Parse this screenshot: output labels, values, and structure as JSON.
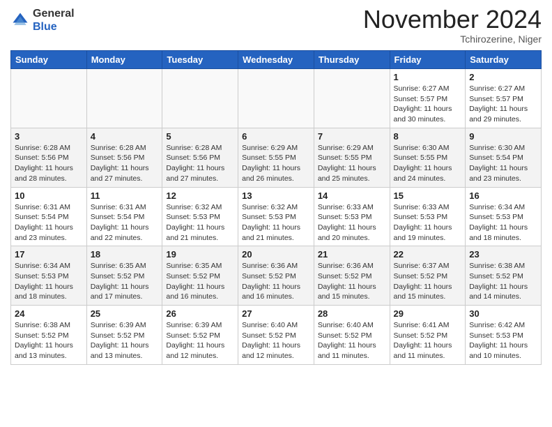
{
  "header": {
    "logo_general": "General",
    "logo_blue": "Blue",
    "month": "November 2024",
    "location": "Tchirozerine, Niger"
  },
  "weekdays": [
    "Sunday",
    "Monday",
    "Tuesday",
    "Wednesday",
    "Thursday",
    "Friday",
    "Saturday"
  ],
  "weeks": [
    [
      {
        "day": "",
        "info": ""
      },
      {
        "day": "",
        "info": ""
      },
      {
        "day": "",
        "info": ""
      },
      {
        "day": "",
        "info": ""
      },
      {
        "day": "",
        "info": ""
      },
      {
        "day": "1",
        "info": "Sunrise: 6:27 AM\nSunset: 5:57 PM\nDaylight: 11 hours and 30 minutes."
      },
      {
        "day": "2",
        "info": "Sunrise: 6:27 AM\nSunset: 5:57 PM\nDaylight: 11 hours and 29 minutes."
      }
    ],
    [
      {
        "day": "3",
        "info": "Sunrise: 6:28 AM\nSunset: 5:56 PM\nDaylight: 11 hours and 28 minutes."
      },
      {
        "day": "4",
        "info": "Sunrise: 6:28 AM\nSunset: 5:56 PM\nDaylight: 11 hours and 27 minutes."
      },
      {
        "day": "5",
        "info": "Sunrise: 6:28 AM\nSunset: 5:56 PM\nDaylight: 11 hours and 27 minutes."
      },
      {
        "day": "6",
        "info": "Sunrise: 6:29 AM\nSunset: 5:55 PM\nDaylight: 11 hours and 26 minutes."
      },
      {
        "day": "7",
        "info": "Sunrise: 6:29 AM\nSunset: 5:55 PM\nDaylight: 11 hours and 25 minutes."
      },
      {
        "day": "8",
        "info": "Sunrise: 6:30 AM\nSunset: 5:55 PM\nDaylight: 11 hours and 24 minutes."
      },
      {
        "day": "9",
        "info": "Sunrise: 6:30 AM\nSunset: 5:54 PM\nDaylight: 11 hours and 23 minutes."
      }
    ],
    [
      {
        "day": "10",
        "info": "Sunrise: 6:31 AM\nSunset: 5:54 PM\nDaylight: 11 hours and 23 minutes."
      },
      {
        "day": "11",
        "info": "Sunrise: 6:31 AM\nSunset: 5:54 PM\nDaylight: 11 hours and 22 minutes."
      },
      {
        "day": "12",
        "info": "Sunrise: 6:32 AM\nSunset: 5:53 PM\nDaylight: 11 hours and 21 minutes."
      },
      {
        "day": "13",
        "info": "Sunrise: 6:32 AM\nSunset: 5:53 PM\nDaylight: 11 hours and 21 minutes."
      },
      {
        "day": "14",
        "info": "Sunrise: 6:33 AM\nSunset: 5:53 PM\nDaylight: 11 hours and 20 minutes."
      },
      {
        "day": "15",
        "info": "Sunrise: 6:33 AM\nSunset: 5:53 PM\nDaylight: 11 hours and 19 minutes."
      },
      {
        "day": "16",
        "info": "Sunrise: 6:34 AM\nSunset: 5:53 PM\nDaylight: 11 hours and 18 minutes."
      }
    ],
    [
      {
        "day": "17",
        "info": "Sunrise: 6:34 AM\nSunset: 5:53 PM\nDaylight: 11 hours and 18 minutes."
      },
      {
        "day": "18",
        "info": "Sunrise: 6:35 AM\nSunset: 5:52 PM\nDaylight: 11 hours and 17 minutes."
      },
      {
        "day": "19",
        "info": "Sunrise: 6:35 AM\nSunset: 5:52 PM\nDaylight: 11 hours and 16 minutes."
      },
      {
        "day": "20",
        "info": "Sunrise: 6:36 AM\nSunset: 5:52 PM\nDaylight: 11 hours and 16 minutes."
      },
      {
        "day": "21",
        "info": "Sunrise: 6:36 AM\nSunset: 5:52 PM\nDaylight: 11 hours and 15 minutes."
      },
      {
        "day": "22",
        "info": "Sunrise: 6:37 AM\nSunset: 5:52 PM\nDaylight: 11 hours and 15 minutes."
      },
      {
        "day": "23",
        "info": "Sunrise: 6:38 AM\nSunset: 5:52 PM\nDaylight: 11 hours and 14 minutes."
      }
    ],
    [
      {
        "day": "24",
        "info": "Sunrise: 6:38 AM\nSunset: 5:52 PM\nDaylight: 11 hours and 13 minutes."
      },
      {
        "day": "25",
        "info": "Sunrise: 6:39 AM\nSunset: 5:52 PM\nDaylight: 11 hours and 13 minutes."
      },
      {
        "day": "26",
        "info": "Sunrise: 6:39 AM\nSunset: 5:52 PM\nDaylight: 11 hours and 12 minutes."
      },
      {
        "day": "27",
        "info": "Sunrise: 6:40 AM\nSunset: 5:52 PM\nDaylight: 11 hours and 12 minutes."
      },
      {
        "day": "28",
        "info": "Sunrise: 6:40 AM\nSunset: 5:52 PM\nDaylight: 11 hours and 11 minutes."
      },
      {
        "day": "29",
        "info": "Sunrise: 6:41 AM\nSunset: 5:52 PM\nDaylight: 11 hours and 11 minutes."
      },
      {
        "day": "30",
        "info": "Sunrise: 6:42 AM\nSunset: 5:53 PM\nDaylight: 11 hours and 10 minutes."
      }
    ]
  ]
}
